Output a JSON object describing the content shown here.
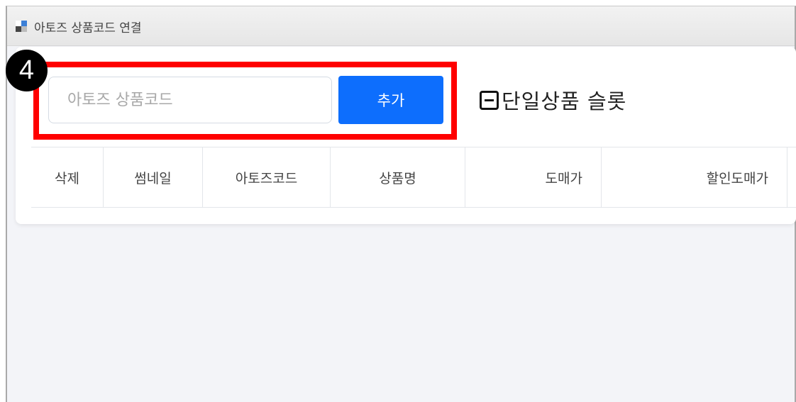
{
  "window": {
    "title": "아토즈 상품코드 연결"
  },
  "step_badge": "4",
  "form": {
    "code_placeholder": "아토즈 상품코드",
    "code_value": "",
    "add_label": "추가",
    "single_option_label": "단일상품 슬롯"
  },
  "table": {
    "columns": [
      "삭제",
      "썸네일",
      "아토즈코드",
      "상품명",
      "도매가",
      "할인도매가"
    ]
  },
  "colors": {
    "accent": "#0d6efd",
    "highlight": "#ff0000",
    "badge": "#000000"
  }
}
